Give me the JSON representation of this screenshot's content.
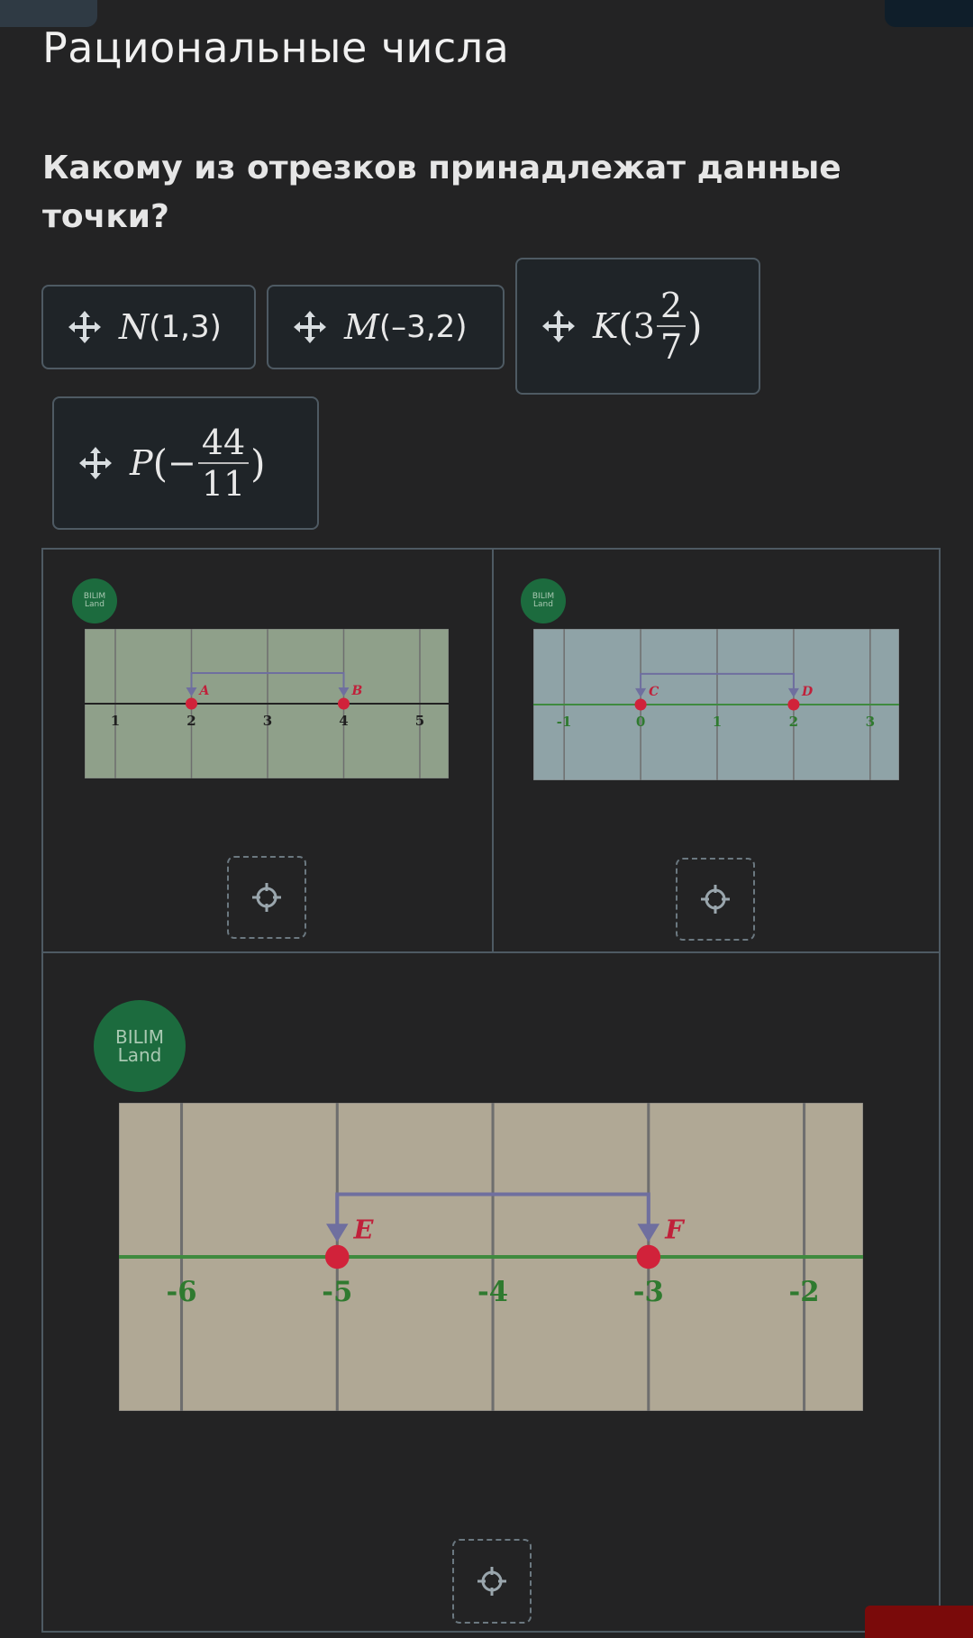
{
  "page": {
    "title": "Рациональные числа"
  },
  "question": {
    "text": "Какому из отрезков принадлежат данные точки?"
  },
  "chips": [
    {
      "id": "N",
      "letter": "N",
      "value": "(1,3)"
    },
    {
      "id": "M",
      "letter": "M",
      "value": "(–3,2)"
    },
    {
      "id": "K",
      "letter": "K",
      "open": "(",
      "whole": "3",
      "num": "2",
      "den": "7",
      "close": ")"
    },
    {
      "id": "P",
      "letter": "P",
      "open": "(",
      "sign": "−",
      "num": "44",
      "den": "11",
      "close": ")"
    }
  ],
  "logo": {
    "line1": "BILIM",
    "line2": "Land"
  },
  "number_lines": [
    {
      "id": "AB",
      "background": "#8fa08a",
      "axis_color": "#222222",
      "tick_label_color": "#1f1f1f",
      "ticks": [
        "1",
        "2",
        "3",
        "4",
        "5"
      ],
      "points": [
        {
          "label": "A",
          "at": "2"
        },
        {
          "label": "B",
          "at": "4"
        }
      ]
    },
    {
      "id": "CD",
      "background": "#8fa3a7",
      "axis_color": "#3f8a3f",
      "tick_label_color": "#2f7a2f",
      "ticks": [
        "-1",
        "0",
        "1",
        "2",
        "3"
      ],
      "points": [
        {
          "label": "C",
          "at": "0"
        },
        {
          "label": "D",
          "at": "2"
        }
      ]
    },
    {
      "id": "EF",
      "background": "#b0a895",
      "axis_color": "#3f8a3f",
      "tick_label_color": "#2f7a2f",
      "ticks": [
        "-6",
        "-5",
        "-4",
        "-3",
        "-2"
      ],
      "points": [
        {
          "label": "E",
          "at": "-5"
        },
        {
          "label": "F",
          "at": "-3"
        }
      ]
    }
  ],
  "colors": {
    "point": "#d1223a",
    "bracket": "#6f6f9f",
    "point_label": "#c0203a"
  },
  "icons": {
    "chip_icon": "move-arrows-icon",
    "drop_icon": "drop-target-icon"
  }
}
